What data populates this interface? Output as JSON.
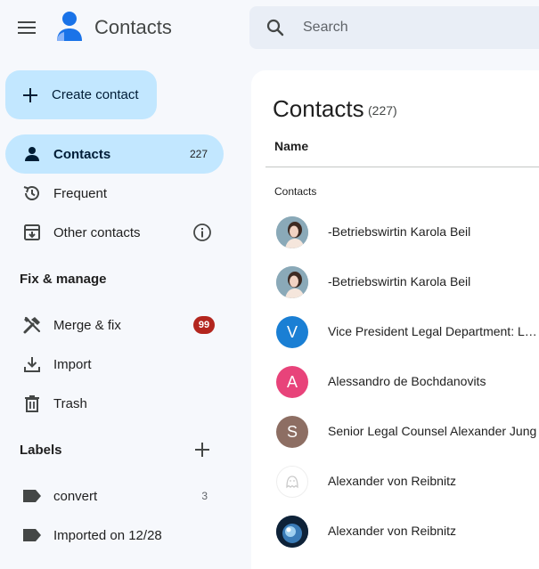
{
  "header": {
    "app_title": "Contacts",
    "search_placeholder": "Search"
  },
  "sidebar": {
    "create_label": "Create contact",
    "nav": [
      {
        "label": "Contacts",
        "count": "227",
        "icon": "person-icon"
      },
      {
        "label": "Frequent",
        "icon": "history-icon"
      },
      {
        "label": "Other contacts",
        "icon": "archive-download-icon",
        "trailing_icon": "info-icon"
      }
    ],
    "fix_manage_title": "Fix & manage",
    "fix_items": [
      {
        "label": "Merge & fix",
        "badge": "99",
        "icon": "tools-icon"
      },
      {
        "label": "Import",
        "icon": "download-icon"
      },
      {
        "label": "Trash",
        "icon": "trash-icon"
      }
    ],
    "labels_title": "Labels",
    "labels": [
      {
        "label": "convert",
        "count": "3",
        "icon": "label-icon"
      },
      {
        "label": "Imported on 12/28",
        "icon": "label-icon"
      }
    ]
  },
  "main": {
    "title": "Contacts",
    "count": "(227)",
    "column_name": "Name",
    "section_label": "Contacts",
    "contacts": [
      {
        "name": "-Betriebswirtin Karola Beil",
        "avatar": "photo",
        "color": "#8aa9b8"
      },
      {
        "name": "-Betriebswirtin Karola Beil",
        "avatar": "photo",
        "color": "#8aa9b8"
      },
      {
        "name": "Vice President Legal Department: Legal Counsel",
        "avatar": "V",
        "color": "#1a7fd4"
      },
      {
        "name": "Alessandro de Bochdanovits",
        "avatar": "A",
        "color": "#e8437a"
      },
      {
        "name": "Senior Legal Counsel Alexander Jung",
        "avatar": "S",
        "color": "#8d6e63"
      },
      {
        "name": "Alexander von Reibnitz",
        "avatar": "ghost",
        "color": "#ffffff"
      },
      {
        "name": "Alexander von Reibnitz",
        "avatar": "photo-dark",
        "color": "#1b3a5c"
      }
    ]
  },
  "colors": {
    "accent": "#c2e7ff",
    "badge": "#b3261e",
    "background": "#f6f8fc"
  }
}
